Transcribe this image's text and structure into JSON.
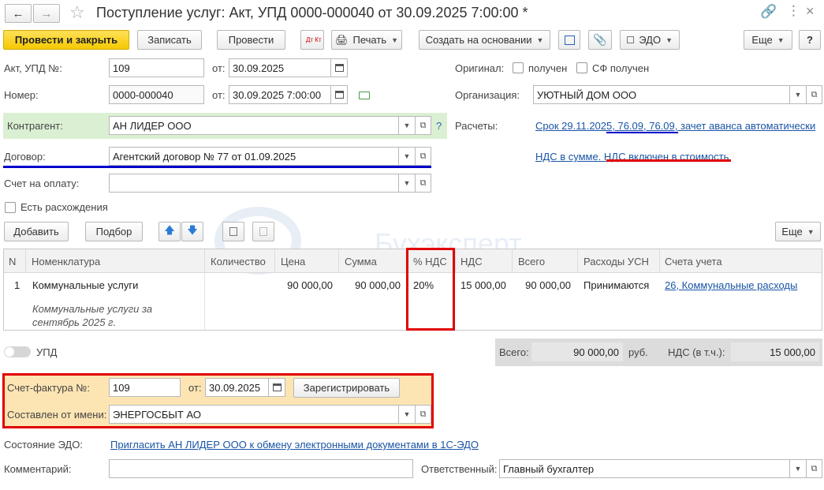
{
  "window": {
    "title": "Поступление услуг: Акт, УПД 0000-000040 от 30.09.2025 7:00:00 *"
  },
  "toolbar": {
    "post_close": "Провести и закрыть",
    "save": "Записать",
    "post": "Провести",
    "dtkt": "Дт Кт",
    "print": "Печать",
    "create_based": "Создать на основании",
    "edo": "ЭДО",
    "more": "Еще",
    "help": "?"
  },
  "form": {
    "act_label": "Акт, УПД №:",
    "act_value": "109",
    "from_label": "от:",
    "act_date": "30.09.2025",
    "number_label": "Номер:",
    "number_value": "0000-000040",
    "number_date": "30.09.2025  7:00:00",
    "contractor_label": "Контрагент:",
    "contractor_value": "АН ЛИДЕР ООО",
    "question": "?",
    "contract_label": "Договор:",
    "contract_value": "Агентский договор № 77 от 01.09.2025",
    "invoice_pay_label": "Счет на оплату:",
    "discrepancy_label": "Есть расхождения",
    "original_label": "Оригинал:",
    "received": "получен",
    "sf_received": "СФ получен",
    "org_label": "Организация:",
    "org_value": "УЮТНЫЙ ДОМ ООО",
    "settlements_label": "Расчеты:",
    "settlements_link": "Срок 29.11.2025, 76.09, 76.09, зачет аванса автоматически",
    "vat_link": "НДС в сумме. НДС включен в стоимость"
  },
  "table_toolbar": {
    "add": "Добавить",
    "pick": "Подбор",
    "more": "Еще"
  },
  "table": {
    "headers": [
      "N",
      "Номенклатура",
      "Количество",
      "Цена",
      "Сумма",
      "% НДС",
      "НДС",
      "Всего",
      "Расходы УСН",
      "Счета учета"
    ],
    "rows": [
      {
        "n": "1",
        "item": "Коммунальные услуги",
        "item_note": "Коммунальные услуги за сентябрь 2025 г.",
        "qty": "",
        "price": "90 000,00",
        "sum": "90 000,00",
        "vat_rate": "20%",
        "vat": "15 000,00",
        "total": "90 000,00",
        "usn": "Принимаются",
        "account": "26, Коммунальные расходы"
      }
    ]
  },
  "watermark": "Бухэксперт",
  "upd_toggle_label": "УПД",
  "totals": {
    "total_label": "Всего:",
    "total_value": "90 000,00",
    "currency": "руб.",
    "vat_label": "НДС (в т.ч.):",
    "vat_value": "15 000,00"
  },
  "invoice": {
    "label": "Счет-фактура №:",
    "number": "109",
    "from_label": "от:",
    "date": "30.09.2025",
    "register": "Зарегистрировать",
    "issued_label": "Составлен от имени:",
    "issued_value": "ЭНЕРГОСБЫТ АО"
  },
  "edo_state": {
    "label": "Состояние ЭДО:",
    "link": "Пригласить АН ЛИДЕР ООО к обмену электронными документами в 1С-ЭДО"
  },
  "comment_label": "Комментарий:",
  "responsible_label": "Ответственный:",
  "responsible_value": "Главный бухгалтер",
  "colors": {
    "accent": "#f5c800",
    "highlight_red": "#e00000",
    "underline_blue": "#0000cc",
    "link": "#1a55a6"
  }
}
